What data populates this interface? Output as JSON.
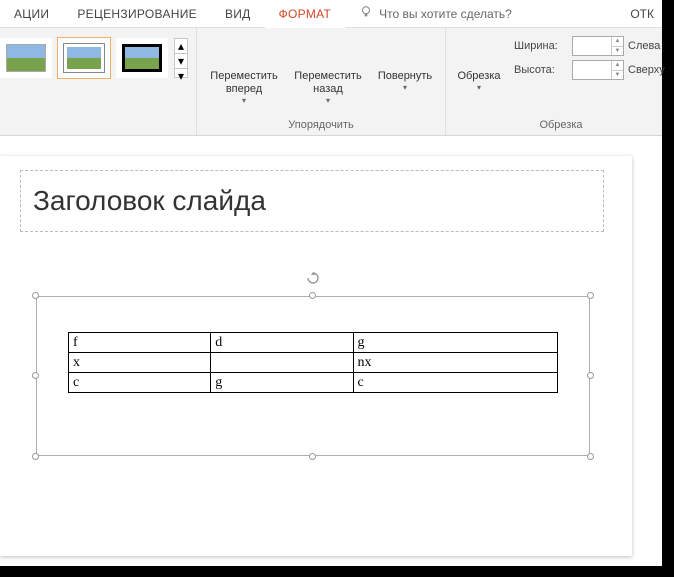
{
  "tabs": {
    "animations": "АЦИИ",
    "review": "РЕЦЕНЗИРОВАНИЕ",
    "view": "ВИД",
    "format": "ФОРМАТ",
    "tellme": "Что вы хотите сделать?",
    "farRight": "ОТК"
  },
  "ribbon": {
    "arrange": {
      "forward": "Переместить\nвперед",
      "backward": "Переместить\nназад",
      "rotate": "Повернуть",
      "groupLabel": "Упорядочить"
    },
    "crop": {
      "crop": "Обрезка",
      "width": "Ширина:",
      "height": "Высота:",
      "left": "Слева",
      "top": "Сверху",
      "groupLabel": "Обрезка"
    }
  },
  "slide": {
    "title": "Заголовок слайда"
  },
  "table": {
    "rows": [
      [
        "f",
        "d",
        "g"
      ],
      [
        "x",
        "",
        "nx"
      ],
      [
        "c",
        "g",
        "c"
      ]
    ],
    "strike": [
      [
        2,
        2
      ]
    ]
  }
}
